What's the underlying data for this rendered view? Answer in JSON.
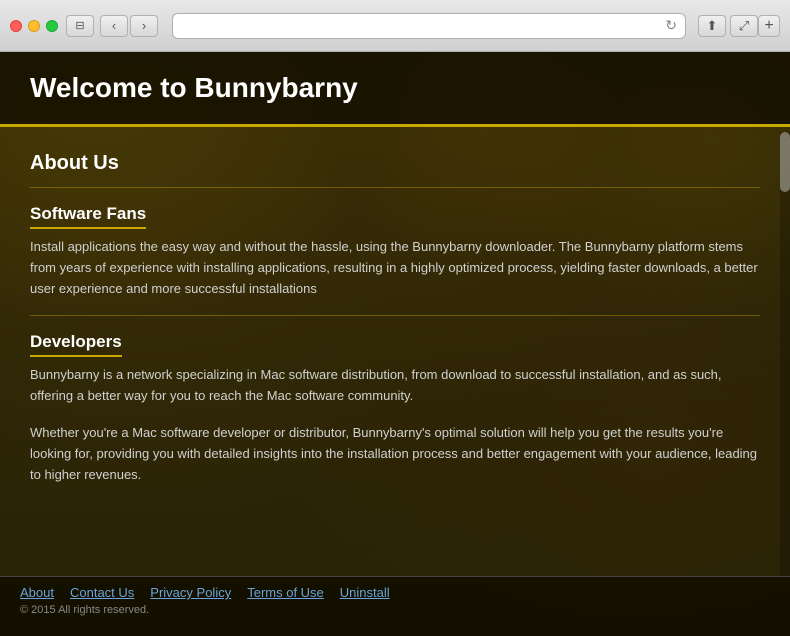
{
  "titlebar": {
    "traffic_lights": [
      "red",
      "yellow",
      "green"
    ],
    "back_label": "‹",
    "forward_label": "›",
    "window_label": "⧉",
    "address": "",
    "reload_label": "↻",
    "share_label": "⬆",
    "fullscreen_label": "⤢",
    "plus_label": "+"
  },
  "page": {
    "title": "Welcome to Bunnybarny",
    "about_us_title": "About Us",
    "software_fans_title": "Software Fans",
    "software_fans_text": "Install applications the easy way and without the hassle, using the Bunnybarny downloader. The Bunnybarny platform stems from years of experience with installing applications, resulting in a highly optimized process, yielding faster downloads, a better user experience and more successful installations",
    "developers_title": "Developers",
    "developers_text1": "Bunnybarny is a network specializing in Mac software distribution, from download to successful installation, and as such, offering a better way for you to reach the Mac software community.",
    "developers_text2": "Whether you're a Mac software developer or distributor, Bunnybarny's optimal solution will help you get the results you're looking for, providing you with detailed insights into the installation process and better engagement with your audience, leading to higher revenues."
  },
  "footer": {
    "links": [
      {
        "label": "About",
        "id": "about"
      },
      {
        "label": "Contact Us",
        "id": "contact"
      },
      {
        "label": "Privacy Policy",
        "id": "privacy"
      },
      {
        "label": "Terms of Use",
        "id": "terms"
      },
      {
        "label": "Uninstall",
        "id": "uninstall"
      }
    ],
    "copyright": "© 2015 All rights reserved."
  }
}
